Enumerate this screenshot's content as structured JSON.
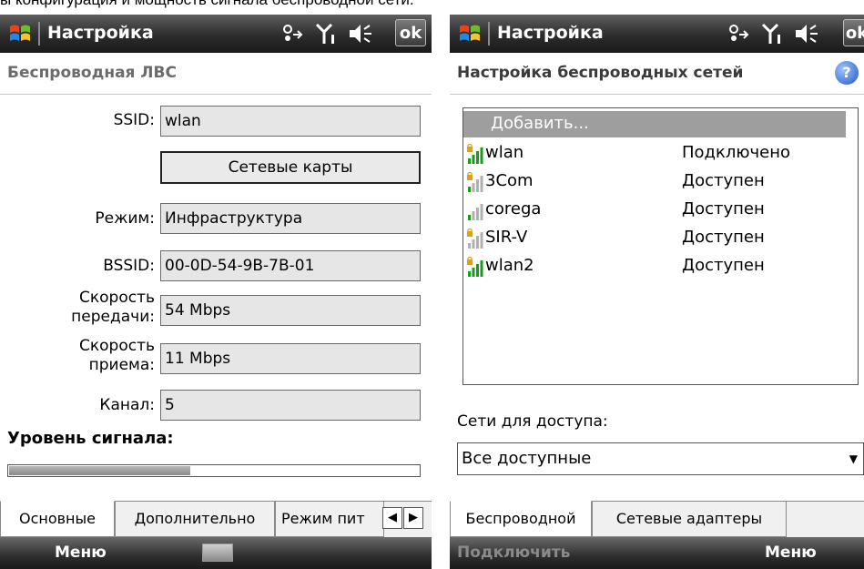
{
  "caption": "ы конфигурация и мощность сигнала беспроводной сети.",
  "left": {
    "title": "Настройка",
    "ok_label": "ok",
    "header": "Беспроводная ЛВС",
    "fields": {
      "ssid_label": "SSID:",
      "ssid_value": "wlan",
      "net_cards_button": "Сетевые карты",
      "mode_label": "Режим:",
      "mode_value": "Инфраструктура",
      "bssid_label": "BSSID:",
      "bssid_value": "00-0D-54-9B-7B-01",
      "tx_rate_label_1": "Скорость",
      "tx_rate_label_2": "передачи:",
      "tx_rate_value": "54 Mbps",
      "rx_rate_label_1": "Скорость",
      "rx_rate_label_2": "приема:",
      "rx_rate_value": "11 Mbps",
      "channel_label": "Канал:",
      "channel_value": "5"
    },
    "signal_label": "Уровень сигнала:",
    "signal_level": 0.44,
    "tabs": [
      "Основные",
      "Дополнительно",
      "Режим пит"
    ],
    "menu_left": "Меню"
  },
  "right": {
    "title": "Настройка",
    "header": "Настройка беспроводных сетей",
    "help_label": "?",
    "add_item": "Добавить...",
    "networks": [
      {
        "name": "wlan",
        "status": "Подключено",
        "bars": 4,
        "secured": true
      },
      {
        "name": "3Com",
        "status": "Доступен",
        "bars": 1,
        "secured": true
      },
      {
        "name": "corega",
        "status": "Доступен",
        "bars": 1,
        "secured": false
      },
      {
        "name": "SIR-V",
        "status": "Доступен",
        "bars": 0,
        "secured": true
      },
      {
        "name": "wlan2",
        "status": "Доступен",
        "bars": 4,
        "secured": true
      }
    ],
    "access_label": "Сети для доступа:",
    "access_value": "Все доступные",
    "tabs": [
      "Беспроводной",
      "Сетевые адаптеры"
    ],
    "menu_left": "Подключить",
    "menu_right": "Меню"
  },
  "colors": {
    "bar_active": "#1a9a1a",
    "bar_inactive": "#b0b0b0",
    "lock": "#d9a21b"
  }
}
